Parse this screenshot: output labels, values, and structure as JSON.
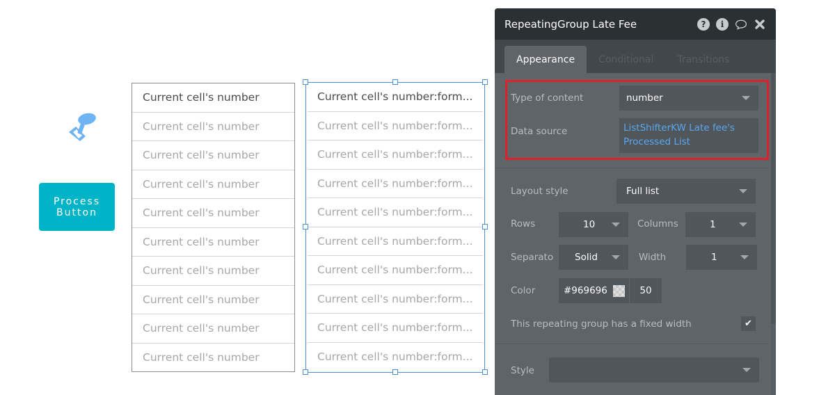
{
  "canvas": {
    "icon": "ui-element-pin-icon",
    "process_button": {
      "line1": "Process",
      "line2": "Button"
    },
    "left_group": {
      "cells": [
        "Current cell's number",
        "Current cell's number",
        "Current cell's number",
        "Current cell's number",
        "Current cell's number",
        "Current cell's number",
        "Current cell's number",
        "Current cell's number",
        "Current cell's number",
        "Current cell's number"
      ]
    },
    "right_group": {
      "cells": [
        "Current cell's number:form...",
        "Current cell's number:form...",
        "Current cell's number:form...",
        "Current cell's number:form...",
        "Current cell's number:form...",
        "Current cell's number:form...",
        "Current cell's number:form...",
        "Current cell's number:form...",
        "Current cell's number:form...",
        "Current cell's number:form..."
      ]
    }
  },
  "panel": {
    "title": "RepeatingGroup Late Fee",
    "title_icons": [
      "help-icon",
      "info-icon",
      "comment-icon",
      "close-icon"
    ],
    "tabs": [
      {
        "label": "Appearance",
        "active": true
      },
      {
        "label": "Conditional",
        "active": false
      },
      {
        "label": "Transitions",
        "active": false
      }
    ],
    "type_of_content": {
      "label": "Type of content",
      "value": "number"
    },
    "data_source": {
      "label": "Data source",
      "value_line1": "ListShifterKW Late fee's",
      "value_line2": "Processed List"
    },
    "layout_style": {
      "label": "Layout style",
      "value": "Full list"
    },
    "rows": {
      "label": "Rows",
      "value": "10"
    },
    "columns": {
      "label": "Columns",
      "value": "1"
    },
    "separator": {
      "label": "Separato",
      "value": "Solid"
    },
    "width": {
      "label": "Width",
      "value": "1"
    },
    "color": {
      "label": "Color",
      "hex": "#969696",
      "opacity": "50"
    },
    "fixed_width": {
      "label": "This repeating group has a fixed width",
      "checked": true,
      "check_glyph": "✔"
    },
    "style": {
      "label": "Style",
      "value": ""
    },
    "highlight_color": "#e0202a",
    "link_color": "#5aa7f0"
  }
}
